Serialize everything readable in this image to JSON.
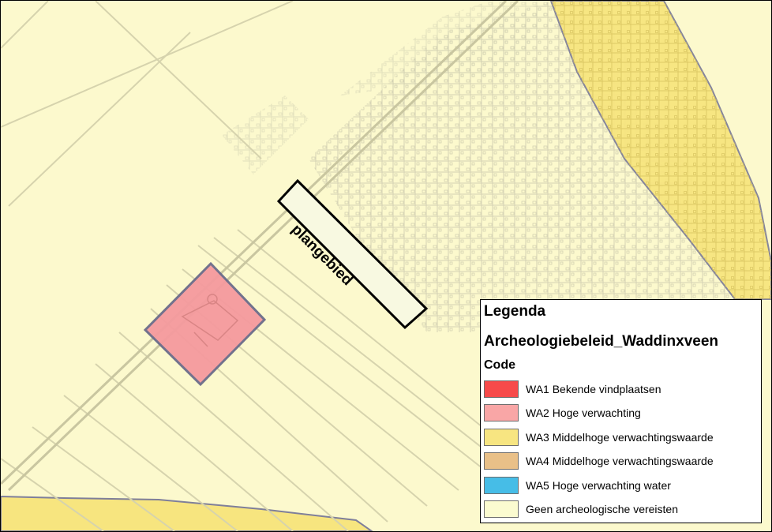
{
  "map": {
    "plan_area_label": "plangebied"
  },
  "legend": {
    "title": "Legenda",
    "layer_name": "Archeologiebeleid_Waddinxveen",
    "field_name": "Code",
    "items": [
      {
        "label": "WA1 Bekende vindplaatsen",
        "color": "#f74a4a"
      },
      {
        "label": "WA2 Hoge verwachting",
        "color": "#f9a6a6"
      },
      {
        "label": "WA3 Middelhoge verwachtingswaarde",
        "color": "#f7e581"
      },
      {
        "label": "WA4 Middelhoge verwachtingswaarde",
        "color": "#e9c088"
      },
      {
        "label": "WA5 Hoge verwachting water",
        "color": "#46bde7"
      },
      {
        "label": "Geen archeologische vereisten",
        "color": "#fbfbd0"
      }
    ]
  }
}
